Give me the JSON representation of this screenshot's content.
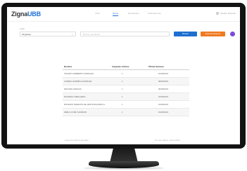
{
  "header": {
    "logo_main": "Zigna",
    "logo_accent": "UBB",
    "nav": [
      "Inicio",
      "Grupo",
      "Estudiantes",
      "Notificaciones"
    ],
    "active_nav": 1,
    "user_label": "Usuario Docente"
  },
  "filter": {
    "label": "Grupo",
    "selected": "Zingeldeo",
    "search_placeholder": "Buscar estudiante",
    "search_button": "Buscar",
    "export_button": "Exportar Reporte"
  },
  "table": {
    "columns": [
      "Nombre",
      "Insignias Activas",
      "Última Semana"
    ],
    "rows": [
      [
        "ÁLVARO HUMBERTO MORALES",
        "1",
        "10/05/2023"
      ],
      [
        "JOSEPH ANDRÉS GONZÁLEZ",
        "1",
        "08/05/2023"
      ],
      [
        "MATHÍAS VARGAS",
        "1",
        "06/05/2023"
      ],
      [
        "RICARDO CABALLERO",
        "1",
        "01/06/2023"
      ],
      [
        "ROSARIO TERESITA DE JESÚS ESCAMILLA",
        "1",
        "01/06/2023"
      ],
      [
        "PABLO JOSÉ THOMSON",
        "1",
        "01/06/2023"
      ]
    ]
  },
  "footer": {
    "left": "Ingrese los criterios para filtrar",
    "right": "Ver más registros, usar los filtros"
  },
  "colors": {
    "primary": "#1e6fd0",
    "accent": "#f07a22",
    "avatar": "#7b4ad8"
  }
}
